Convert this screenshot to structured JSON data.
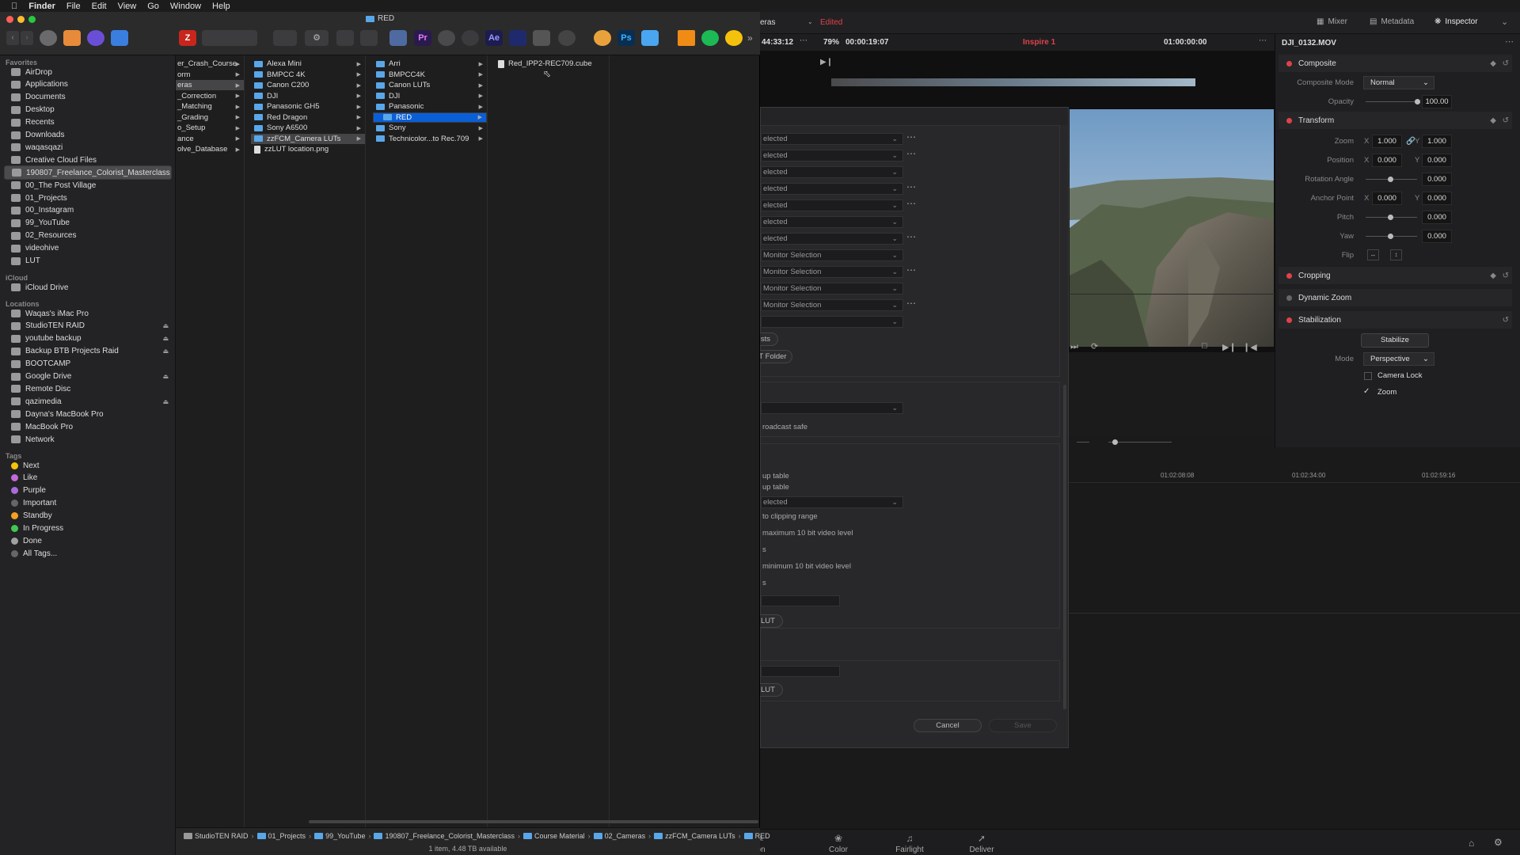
{
  "menubar": {
    "app": "Finder",
    "items": [
      "File",
      "Edit",
      "View",
      "Go",
      "Window",
      "Help"
    ]
  },
  "finder": {
    "title": "RED",
    "sidebar": {
      "favorites_head": "Favorites",
      "favorites": [
        "AirDrop",
        "Applications",
        "Documents",
        "Desktop",
        "Recents",
        "Downloads",
        "waqasqazi",
        "Creative Cloud Files",
        "190807_Freelance_Colorist_Masterclass",
        "00_The Post Village",
        "01_Projects",
        "00_Instagram",
        "99_YouTube",
        "02_Resources",
        "videohive",
        "LUT"
      ],
      "icloud_head": "iCloud",
      "icloud": [
        "iCloud Drive"
      ],
      "locations_head": "Locations",
      "locations": [
        "Waqas's iMac Pro",
        "StudioTEN RAID",
        "youtube backup",
        "Backup BTB Projects Raid",
        "BOOTCAMP",
        "Google Drive",
        "Remote Disc",
        "qazimedia",
        "Dayna's MacBook Pro",
        "MacBook Pro",
        "Network"
      ],
      "tags_head": "Tags",
      "tags": [
        "Next",
        "Like",
        "Purple",
        "Important",
        "Standby",
        "In Progress",
        "Done",
        "All Tags..."
      ],
      "tag_colors": [
        "#f3c20b",
        "#c26ad8",
        "#a86bd9",
        "#666666",
        "#f59f25",
        "#43c752",
        "#a0a0a0",
        "#666666"
      ]
    },
    "col1": [
      "er_Crash_Course",
      "orm",
      "eras",
      "_Correction",
      "_Matching",
      "_Grading",
      "o_Setup",
      "ance",
      "olve_Database"
    ],
    "col2": [
      "Alexa Mini",
      "BMPCC 4K",
      "Canon C200",
      "DJI",
      "Panasonic GH5",
      "Red Dragon",
      "Sony A6500",
      "zzFCM_Camera LUTs",
      "zzLUT location.png"
    ],
    "col3": [
      "Arri",
      "BMPCC4K",
      "Canon LUTs",
      "DJI",
      "Panasonic",
      "RED",
      "Sony",
      "Technicolor...to Rec.709"
    ],
    "col4": [
      "Red_IPP2-REC709.cube"
    ],
    "pathbar": [
      "StudioTEN RAID",
      "01_Projects",
      "99_YouTube",
      "190807_Freelance_Colorist_Masterclass",
      "Course Material",
      "02_Cameras",
      "zzFCM_Camera LUTs",
      "RED"
    ],
    "status": "1 item, 4.48 TB available"
  },
  "resolve": {
    "tabs": {
      "mixer": "Mixer",
      "metadata": "Metadata",
      "inspector": "Inspector"
    },
    "project": "eras",
    "edited": "Edited",
    "timecode_left": "44:33:12",
    "zoom": "79%",
    "duration": "00:00:19:07",
    "timeline_name": "Inspire 1",
    "timecode_right": "01:00:00:00",
    "clip_name": "DJI_0132.MOV",
    "ruler": [
      "01:02:08:08",
      "01:02:34:00",
      "01:02:59:16"
    ],
    "inspector": {
      "composite": "Composite",
      "composite_mode_label": "Composite Mode",
      "composite_mode": "Normal",
      "opacity_label": "Opacity",
      "opacity": "100.00",
      "transform": "Transform",
      "zoom_label": "Zoom",
      "zoom_x": "1.000",
      "zoom_y": "1.000",
      "position_label": "Position",
      "pos_x": "0.000",
      "pos_y": "0.000",
      "rotation_label": "Rotation Angle",
      "rotation": "0.000",
      "anchor_label": "Anchor Point",
      "anchor_x": "0.000",
      "anchor_y": "0.000",
      "pitch_label": "Pitch",
      "pitch": "0.000",
      "yaw_label": "Yaw",
      "yaw": "0.000",
      "flip_label": "Flip",
      "cropping": "Cropping",
      "dynamic_zoom": "Dynamic Zoom",
      "stabilization": "Stabilization",
      "stabilize_btn": "Stabilize",
      "mode_label": "Mode",
      "mode": "Perspective",
      "camera_lock": "Camera Lock",
      "zoom_check": "Zoom",
      "x": "X",
      "y": "Y"
    },
    "dialog": {
      "rows": [
        "elected",
        "elected",
        "elected",
        "elected",
        "elected",
        "elected",
        "elected",
        "Monitor Selection",
        "Monitor Selection",
        "Monitor Selection",
        "Monitor Selection",
        ""
      ],
      "btn_lists": "sts",
      "btn_folder": "T Folder",
      "broadcast": "roadcast safe",
      "lookup1": "up table",
      "lookup2": "up table",
      "sel_mid": "elected",
      "clip_range": "to clipping range",
      "max_level": "maximum 10 bit video level",
      "s1": "s",
      "s2": "s",
      "min_level": "minimum 10 bit video level",
      "lut1": "LUT",
      "lut2": "LUT",
      "cancel": "Cancel",
      "save": "Save"
    },
    "bottom_tabs": [
      "ion",
      "Color",
      "Fairlight",
      "Deliver"
    ]
  }
}
